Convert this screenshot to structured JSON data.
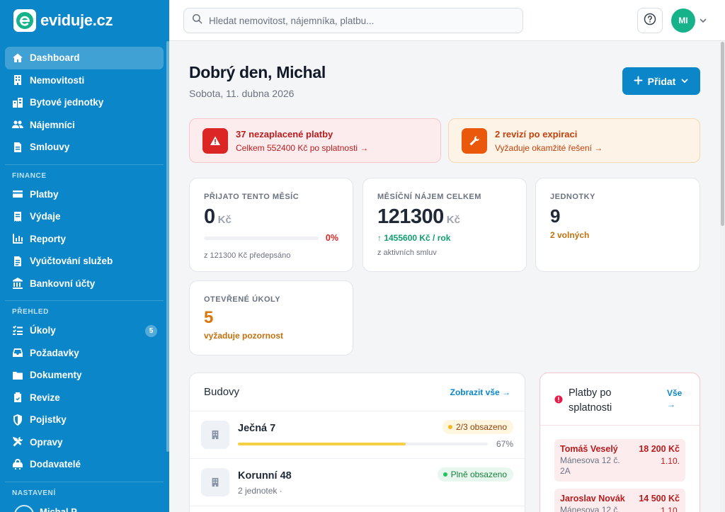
{
  "brand": {
    "name": "eviduje.cz"
  },
  "search": {
    "placeholder": "Hledat nemovitost, nájemníka, platbu..."
  },
  "user": {
    "initials": "MI",
    "name_peek": "Michal P"
  },
  "sidebar": {
    "items": [
      {
        "label": "Dashboard",
        "icon": "home-icon",
        "active": true
      },
      {
        "label": "Nemovitosti",
        "icon": "building-icon"
      },
      {
        "label": "Bytové jednotky",
        "icon": "apartment-icon"
      },
      {
        "label": "Nájemníci",
        "icon": "users-icon"
      },
      {
        "label": "Smlouvy",
        "icon": "contract-icon"
      }
    ],
    "finance_title": "FINANCE",
    "finance": [
      {
        "label": "Platby",
        "icon": "card-icon"
      },
      {
        "label": "Výdaje",
        "icon": "receipt-icon"
      },
      {
        "label": "Reporty",
        "icon": "chart-icon"
      },
      {
        "label": "Vyúčtování služeb",
        "icon": "invoice-icon"
      },
      {
        "label": "Bankovní účty",
        "icon": "bank-icon"
      }
    ],
    "overview_title": "PŘEHLED",
    "overview": [
      {
        "label": "Úkoly",
        "icon": "tasks-icon",
        "badge": "5"
      },
      {
        "label": "Požadavky",
        "icon": "inbox-icon"
      },
      {
        "label": "Dokumenty",
        "icon": "folder-icon"
      },
      {
        "label": "Revize",
        "icon": "clipboard-icon"
      },
      {
        "label": "Pojistky",
        "icon": "shield-icon"
      },
      {
        "label": "Opravy",
        "icon": "tools-icon"
      },
      {
        "label": "Dodavatelé",
        "icon": "truck-icon"
      }
    ],
    "settings_title": "NASTAVENÍ"
  },
  "header": {
    "greeting": "Dobrý den, Michal",
    "date": "Sobota, 11. dubna 2026",
    "add_label": "Přidat"
  },
  "alerts": [
    {
      "title": "37 nezaplacené platby",
      "sub": "Celkem 552400 Kč po splatnosti →"
    },
    {
      "title": "2 revizí po expiraci",
      "sub": "Vyžaduje okamžité řešení →"
    }
  ],
  "stats": {
    "received": {
      "label": "PŘIJATO TENTO MĚSÍC",
      "value": "0",
      "unit": "Kč",
      "pct": "0%",
      "progress": 0,
      "note": "z 121300 Kč předepsáno"
    },
    "rent": {
      "label": "MĚSÍČNÍ NÁJEM CELKEM",
      "value": "121300",
      "unit": "Kč",
      "yearly": "↑ 1455600 Kč / rok",
      "note": "z aktivních smluv"
    },
    "units": {
      "label": "JEDNOTKY",
      "value": "9",
      "note": "2 volných"
    },
    "tasks": {
      "label": "OTEVŘENÉ ÚKOLY",
      "value": "5",
      "note": "vyžaduje pozornost"
    }
  },
  "buildings": {
    "title": "Budovy",
    "link": "Zobrazit vše →",
    "rows": [
      {
        "name": "Ječná 7",
        "status": "2/3 obsazeno",
        "occupancy": 67,
        "pct": "67%"
      },
      {
        "name": "Korunní 48",
        "sub": "2 jednotek ·",
        "status": "Plně obsazeno"
      }
    ]
  },
  "overdue": {
    "title": "Platby po splatnosti",
    "link": "Vše →",
    "items": [
      {
        "name": "Tomáš Veselý",
        "addr": "Mánesova 12 č. 2A",
        "amount": "18 200 Kč",
        "date": "1.10."
      },
      {
        "name": "Jaroslav Novák",
        "addr": "Mánesova 12 č.",
        "amount": "14 500 Kč",
        "date": "1.10."
      }
    ]
  },
  "colors": {
    "brand": "#0b87c9",
    "danger": "#dc2626",
    "warning": "#ea580c",
    "success": "#16b38a"
  }
}
